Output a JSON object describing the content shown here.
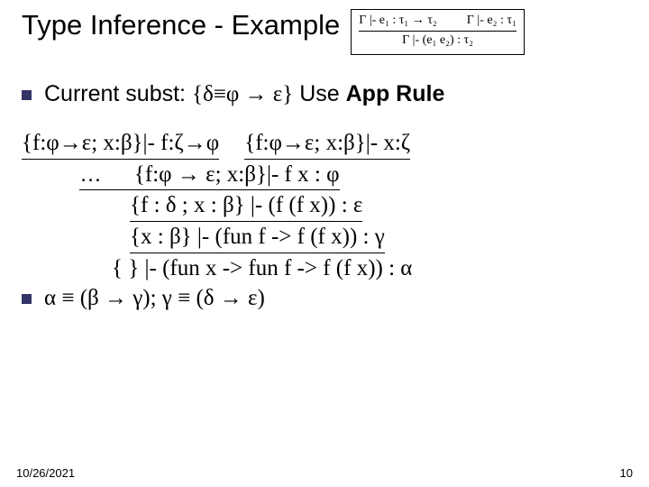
{
  "title": "Type Inference - Example",
  "rulebox": {
    "top_left": "Γ |- e₁ : τ₁ → τ₂",
    "top_right": "Γ |- e₂ : τ₁",
    "bottom": "Γ |- (e₁ e₂) : τ₂"
  },
  "bullet1": {
    "prefix": "Current subst: ",
    "subst": "{δ≡φ → ε}",
    "mid": " Use ",
    "bold": "App Rule"
  },
  "deriv": {
    "premise_left": "{f:φ→ε; x:β}|- f:ζ→φ",
    "premise_right": "{f:φ→ε; x:β}|- x:ζ",
    "line2_left": "…",
    "line2_right": "{f:φ → ε; x:β}|- f x : φ",
    "line3": "{f : δ ; x : β} |- (f (f x)) : ε",
    "line4": "{x : β} |- (fun f -> f (f x)) : γ",
    "line5": "{ } |- (fun x -> fun f -> f (f x)) : α"
  },
  "result": "α ≡ (β → γ); γ ≡ (δ → ε)",
  "footer": {
    "date": "10/26/2021",
    "page": "10"
  }
}
